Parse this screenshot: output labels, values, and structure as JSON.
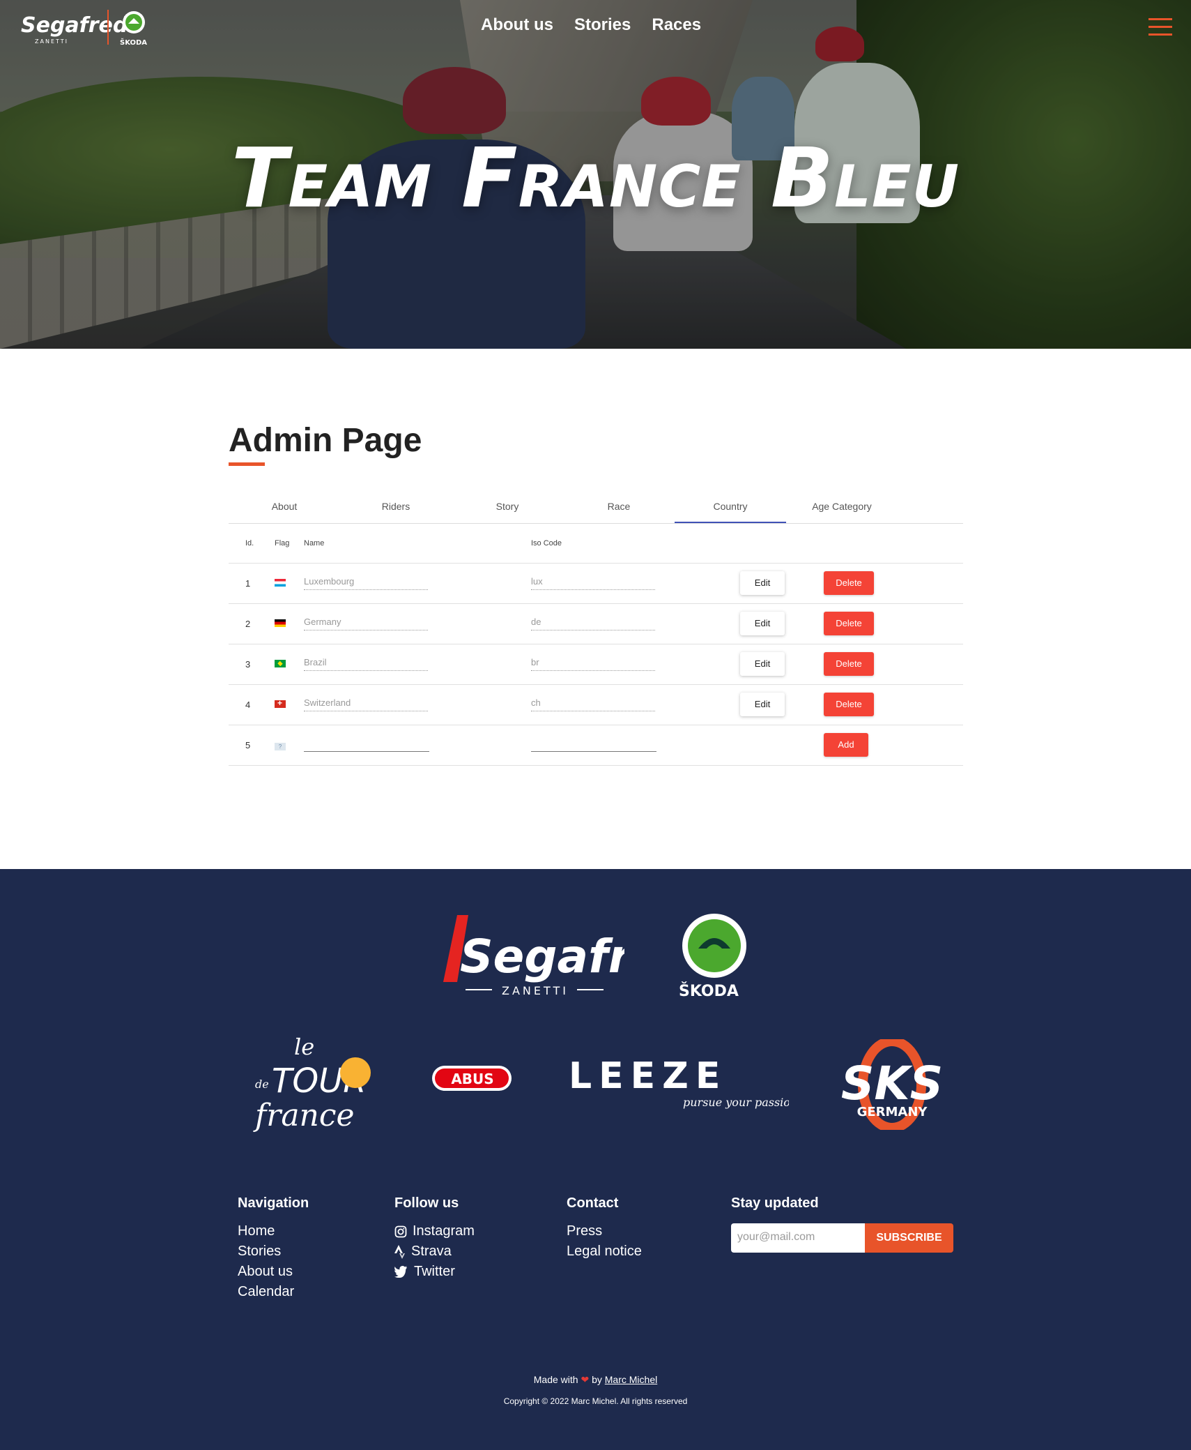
{
  "header": {
    "brand": {
      "name": "Segafredo",
      "sub": "ZANETTI",
      "partner": "ŠKODA"
    },
    "nav": [
      "About us",
      "Stories",
      "Races"
    ],
    "hero_title": "Team France Bleu"
  },
  "admin": {
    "title": "Admin Page",
    "tabs": [
      "About",
      "Riders",
      "Story",
      "Race",
      "Country",
      "Age Category"
    ],
    "active_tab": "Country",
    "columns": {
      "id": "Id.",
      "flag": "Flag",
      "name": "Name",
      "iso": "Iso Code"
    },
    "rows": [
      {
        "id": "1",
        "flag": "luxembourg-flag",
        "name": "Luxembourg",
        "iso": "lux"
      },
      {
        "id": "2",
        "flag": "germany-flag",
        "name": "Germany",
        "iso": "de"
      },
      {
        "id": "3",
        "flag": "brazil-flag",
        "name": "Brazil",
        "iso": "br"
      },
      {
        "id": "4",
        "flag": "switzerland-flag",
        "name": "Switzerland",
        "iso": "ch"
      }
    ],
    "new_row": {
      "id": "5",
      "flag": "unknown-flag",
      "name": "",
      "iso": ""
    },
    "buttons": {
      "edit": "Edit",
      "delete": "Delete",
      "add": "Add"
    },
    "colors": {
      "accent": "#e8542a",
      "tab_indicator": "#3f51b5",
      "danger": "#f44336"
    }
  },
  "footer": {
    "sponsors_main": [
      {
        "name": "Segafredo",
        "sub": "ZANETTI"
      },
      {
        "name": "ŠKODA"
      }
    ],
    "sponsors_secondary": [
      {
        "name": "le Tour de France",
        "words": [
          "le",
          "de",
          "TOUR",
          "france"
        ]
      },
      {
        "name": "ABUS"
      },
      {
        "name": "LEEZE",
        "tagline": "pursue your passion"
      },
      {
        "name": "SKS",
        "sub": "GERMANY"
      }
    ],
    "navigation": {
      "title": "Navigation",
      "links": [
        "Home",
        "Stories",
        "About us",
        "Calendar"
      ]
    },
    "follow": {
      "title": "Follow us",
      "links": [
        {
          "label": "Instagram",
          "icon": "instagram-icon"
        },
        {
          "label": "Strava",
          "icon": "strava-icon"
        },
        {
          "label": "Twitter",
          "icon": "twitter-icon"
        }
      ]
    },
    "contact": {
      "title": "Contact",
      "links": [
        "Press",
        "Legal notice"
      ]
    },
    "newsletter": {
      "title": "Stay updated",
      "placeholder": "your@mail.com",
      "button": "SUBSCRIBE"
    },
    "made_with": {
      "prefix": "Made with",
      "by": "by",
      "author": "Marc Michel"
    },
    "copyright": "Copyright © 2022 Marc Michel. All rights reserved",
    "colors": {
      "background": "#1e2a4d",
      "accent": "#e8542a"
    }
  }
}
